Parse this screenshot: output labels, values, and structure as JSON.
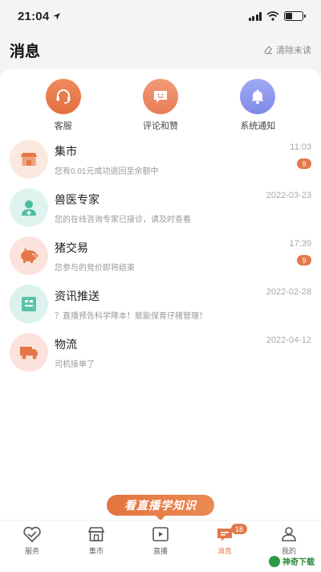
{
  "status_bar": {
    "time": "21:04"
  },
  "header": {
    "title": "消息",
    "clear_label": "清除未读"
  },
  "quick_actions": [
    {
      "label": "客服",
      "icon": "headset-icon",
      "color": "#e8764a"
    },
    {
      "label": "评论和赞",
      "icon": "comment-smile-icon",
      "color": "#ec8862"
    },
    {
      "label": "系统通知",
      "icon": "bell-icon",
      "color": "#8f99ef"
    }
  ],
  "messages": [
    {
      "title": "集市",
      "preview": "您有0.01元成功退回至余额中",
      "time": "11:03",
      "badge": "9",
      "icon": "shop-icon",
      "bg": "#fbe8df",
      "fg": "#e2784a"
    },
    {
      "title": "兽医专家",
      "preview": "您的在线咨询专家已接诊，请及时查看",
      "time": "2022-03-23",
      "badge": "",
      "icon": "doctor-icon",
      "bg": "#dff4ef",
      "fg": "#4bbf9f"
    },
    {
      "title": "猪交易",
      "preview": "您参与的竞价即将结束",
      "time": "17:39",
      "badge": "9",
      "icon": "pig-icon",
      "bg": "#fbe3dc",
      "fg": "#e2784a"
    },
    {
      "title": "资讯推送",
      "preview": "？直播预告科学降本！赋能保育仔猪管理！",
      "time": "2022-02-28",
      "badge": "",
      "icon": "news-icon",
      "bg": "#dcf2ec",
      "fg": "#5cc4a8"
    },
    {
      "title": "物流",
      "preview": "司机接单了",
      "time": "2022-04-12",
      "badge": "",
      "icon": "truck-icon",
      "bg": "#fbe3dc",
      "fg": "#e2784a"
    }
  ],
  "promo": {
    "text": "看直播学知识"
  },
  "tabs": [
    {
      "label": "服务",
      "icon": "service-icon",
      "active": false
    },
    {
      "label": "集市",
      "icon": "market-icon",
      "active": false
    },
    {
      "label": "直播",
      "icon": "live-icon",
      "active": false
    },
    {
      "label": "消息",
      "icon": "message-icon",
      "active": true,
      "badge": "18"
    },
    {
      "label": "我的",
      "icon": "profile-icon",
      "active": false
    }
  ],
  "watermark": {
    "text": "神奇下载"
  },
  "colors": {
    "accent": "#e2784a",
    "background": "#f4f4f6"
  }
}
